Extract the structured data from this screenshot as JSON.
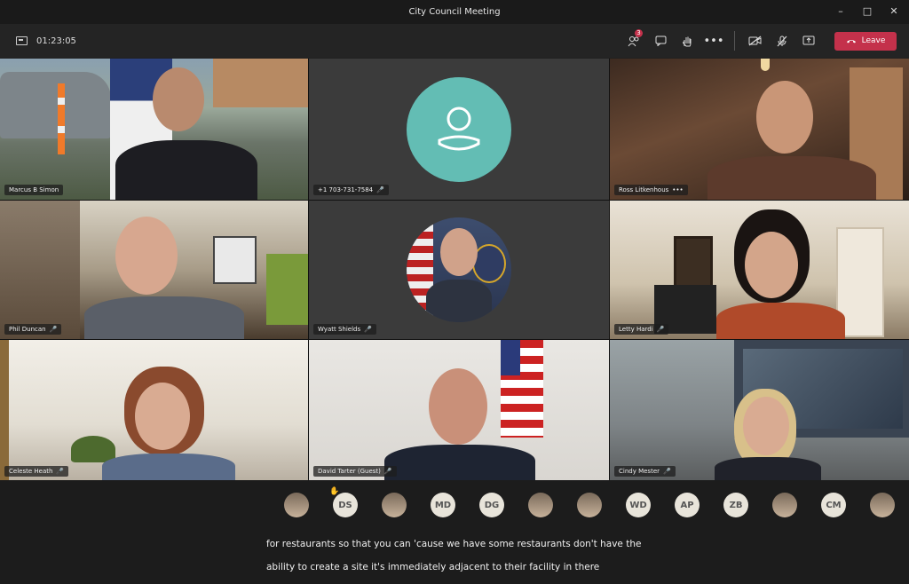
{
  "window": {
    "title": "City Council Meeting"
  },
  "toolbar": {
    "timer": "01:23:05",
    "participants_badge": "3",
    "leave_label": "Leave"
  },
  "tiles": [
    {
      "name": "Marcus B Simon"
    },
    {
      "name": "+1 703-731-7584"
    },
    {
      "name": "Ross Litkenhous"
    },
    {
      "name": "Phil Duncan"
    },
    {
      "name": "Wyatt Shields"
    },
    {
      "name": "Letty Hardi"
    },
    {
      "name": "Celeste Heath"
    },
    {
      "name": "David Tarter (Guest)"
    },
    {
      "name": "Cindy Mester"
    }
  ],
  "participants": [
    {
      "initials": "",
      "type": "photo"
    },
    {
      "initials": "DS",
      "type": "initials",
      "hand": true
    },
    {
      "initials": "",
      "type": "photo"
    },
    {
      "initials": "MD",
      "type": "initials"
    },
    {
      "initials": "DG",
      "type": "initials"
    },
    {
      "initials": "",
      "type": "photo"
    },
    {
      "initials": "",
      "type": "photo"
    },
    {
      "initials": "WD",
      "type": "initials"
    },
    {
      "initials": "AP",
      "type": "initials"
    },
    {
      "initials": "ZB",
      "type": "initials"
    },
    {
      "initials": "",
      "type": "photo"
    },
    {
      "initials": "CM",
      "type": "initials"
    },
    {
      "initials": "",
      "type": "photo"
    }
  ],
  "captions": {
    "line1": "for restaurants so that you can 'cause we have some restaurants don't have the",
    "line2": "ability to create a site it's immediately adjacent to their facility in there"
  },
  "colors": {
    "leave_button": "#c4314b",
    "default_avatar": "#63bdb4",
    "background": "#1f1f1f"
  }
}
